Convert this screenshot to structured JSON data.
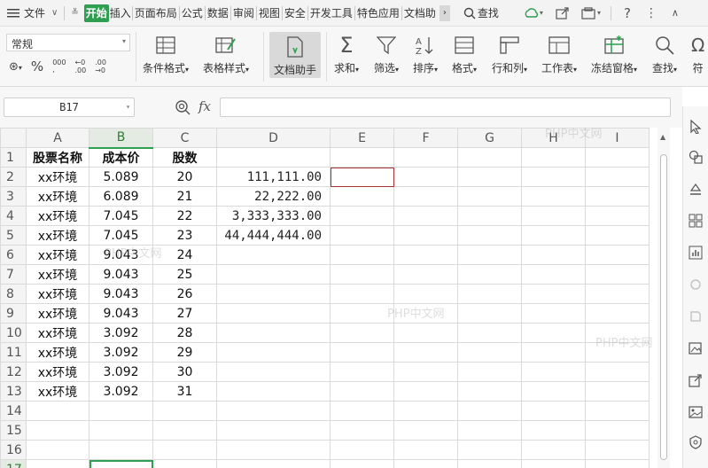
{
  "menubar": {
    "file_label": "文件",
    "tabs": [
      "开始",
      "插入",
      "页面布局",
      "公式",
      "数据",
      "审阅",
      "视图",
      "安全",
      "开发工具",
      "特色应用",
      "文档助"
    ],
    "search_label": "查找"
  },
  "ribbon": {
    "number_format": "常规",
    "conditional_format": "条件格式",
    "table_style": "表格样式",
    "doc_helper": "文档助手",
    "sum": "求和",
    "filter": "筛选",
    "sort": "排序",
    "format": "格式",
    "row_col": "行和列",
    "worksheet": "工作表",
    "freeze": "冻结窗格",
    "find": "查找",
    "symbol": "符"
  },
  "formula_bar": {
    "cell_ref": "B17",
    "fx_label": "fx",
    "content": ""
  },
  "columns": [
    "A",
    "B",
    "C",
    "D",
    "E",
    "F",
    "G",
    "H",
    "I"
  ],
  "rows": [
    {
      "n": "1",
      "a": "股票名称",
      "b": "成本价",
      "c": "股数",
      "d": ""
    },
    {
      "n": "2",
      "a": "xx环境",
      "b": "5.089",
      "c": "20",
      "d": "111,111.00"
    },
    {
      "n": "3",
      "a": "xx环境",
      "b": "6.089",
      "c": "21",
      "d": "22,222.00"
    },
    {
      "n": "4",
      "a": "xx环境",
      "b": "7.045",
      "c": "22",
      "d": "3,333,333.00"
    },
    {
      "n": "5",
      "a": "xx环境",
      "b": "7.045",
      "c": "23",
      "d": "44,444,444.00"
    },
    {
      "n": "6",
      "a": "xx环境",
      "b": "9.043",
      "c": "24",
      "d": ""
    },
    {
      "n": "7",
      "a": "xx环境",
      "b": "9.043",
      "c": "25",
      "d": ""
    },
    {
      "n": "8",
      "a": "xx环境",
      "b": "9.043",
      "c": "26",
      "d": ""
    },
    {
      "n": "9",
      "a": "xx环境",
      "b": "9.043",
      "c": "27",
      "d": ""
    },
    {
      "n": "10",
      "a": "xx环境",
      "b": "3.092",
      "c": "28",
      "d": ""
    },
    {
      "n": "11",
      "a": "xx环境",
      "b": "3.092",
      "c": "29",
      "d": ""
    },
    {
      "n": "12",
      "a": "xx环境",
      "b": "3.092",
      "c": "30",
      "d": ""
    },
    {
      "n": "13",
      "a": "xx环境",
      "b": "3.092",
      "c": "31",
      "d": ""
    },
    {
      "n": "14",
      "a": "",
      "b": "",
      "c": "",
      "d": ""
    },
    {
      "n": "15",
      "a": "",
      "b": "",
      "c": "",
      "d": ""
    },
    {
      "n": "16",
      "a": "",
      "b": "",
      "c": "",
      "d": ""
    },
    {
      "n": "17",
      "a": "",
      "b": "",
      "c": "",
      "d": ""
    }
  ],
  "watermarks": [
    "PHP中文网",
    "PHP中文网",
    "PHP中文网",
    "PHP中文网"
  ],
  "colors": {
    "accent": "#2e9e50",
    "selection_e": "#aa3333"
  }
}
